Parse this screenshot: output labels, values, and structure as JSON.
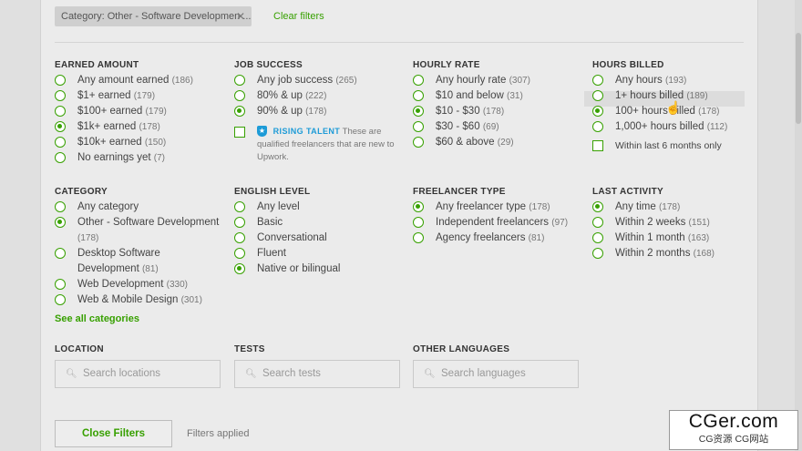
{
  "filter_chip": {
    "label": "Category: Other - Software Developmen ...",
    "close": "✕"
  },
  "clear_filters": "Clear filters",
  "earned_amount": {
    "title": "EARNED AMOUNT",
    "options": [
      {
        "label": "Any amount earned",
        "count": "(186)",
        "selected": false
      },
      {
        "label": "$1+ earned",
        "count": "(179)",
        "selected": false
      },
      {
        "label": "$100+ earned",
        "count": "(179)",
        "selected": false
      },
      {
        "label": "$1k+ earned",
        "count": "(178)",
        "selected": true
      },
      {
        "label": "$10k+ earned",
        "count": "(150)",
        "selected": false
      },
      {
        "label": "No earnings yet",
        "count": "(7)",
        "selected": false
      }
    ]
  },
  "job_success": {
    "title": "JOB SUCCESS",
    "options": [
      {
        "label": "Any job success",
        "count": "(265)",
        "selected": false
      },
      {
        "label": "80% & up",
        "count": "(222)",
        "selected": false
      },
      {
        "label": "90% & up",
        "count": "(178)",
        "selected": true
      }
    ],
    "rising_talent": {
      "label": "RISING TALENT",
      "text": "These are qualified freelancers that are new to Upwork."
    }
  },
  "hourly_rate": {
    "title": "HOURLY RATE",
    "options": [
      {
        "label": "Any hourly rate",
        "count": "(307)",
        "selected": false
      },
      {
        "label": "$10 and below",
        "count": "(31)",
        "selected": false
      },
      {
        "label": "$10 - $30",
        "count": "(178)",
        "selected": true
      },
      {
        "label": "$30 - $60",
        "count": "(69)",
        "selected": false
      },
      {
        "label": "$60 & above",
        "count": "(29)",
        "selected": false
      }
    ]
  },
  "hours_billed": {
    "title": "HOURS BILLED",
    "options": [
      {
        "label": "Any hours",
        "count": "(193)",
        "selected": false
      },
      {
        "label": "1+ hours billed",
        "count": "(189)",
        "selected": false
      },
      {
        "label": "100+ hours billed",
        "count": "(178)",
        "selected": true
      },
      {
        "label": "1,000+ hours billed",
        "count": "(112)",
        "selected": false
      }
    ],
    "recent": "Within last 6 months only"
  },
  "category": {
    "title": "CATEGORY",
    "options": [
      {
        "label": "Any category",
        "count": "",
        "selected": false
      },
      {
        "label": "Other - Software Development",
        "count": "(178)",
        "selected": true
      },
      {
        "label": "Desktop Software Development",
        "count": "(81)",
        "selected": false
      },
      {
        "label": "Web Development",
        "count": "(330)",
        "selected": false
      },
      {
        "label": "Web & Mobile Design",
        "count": "(301)",
        "selected": false
      }
    ],
    "see_all": "See all categories"
  },
  "english_level": {
    "title": "ENGLISH LEVEL",
    "options": [
      {
        "label": "Any level",
        "count": "",
        "selected": false
      },
      {
        "label": "Basic",
        "count": "",
        "selected": false
      },
      {
        "label": "Conversational",
        "count": "",
        "selected": false
      },
      {
        "label": "Fluent",
        "count": "",
        "selected": false
      },
      {
        "label": "Native or bilingual",
        "count": "",
        "selected": true
      }
    ]
  },
  "freelancer_type": {
    "title": "FREELANCER TYPE",
    "options": [
      {
        "label": "Any freelancer type",
        "count": "(178)",
        "selected": true
      },
      {
        "label": "Independent freelancers",
        "count": "(97)",
        "selected": false
      },
      {
        "label": "Agency freelancers",
        "count": "(81)",
        "selected": false
      }
    ]
  },
  "last_activity": {
    "title": "LAST ACTIVITY",
    "options": [
      {
        "label": "Any time",
        "count": "(178)",
        "selected": true
      },
      {
        "label": "Within 2 weeks",
        "count": "(151)",
        "selected": false
      },
      {
        "label": "Within 1 month",
        "count": "(163)",
        "selected": false
      },
      {
        "label": "Within 2 months",
        "count": "(168)",
        "selected": false
      }
    ]
  },
  "location": {
    "title": "LOCATION",
    "placeholder": "Search locations"
  },
  "tests": {
    "title": "TESTS",
    "placeholder": "Search tests"
  },
  "languages": {
    "title": "OTHER LANGUAGES",
    "placeholder": "Search languages"
  },
  "close_filters": "Close Filters",
  "filters_applied": "Filters applied",
  "watermark": {
    "big": "CGer.com",
    "small": "CG资源 CG网站"
  },
  "colors": {
    "accent": "#37a000",
    "rising": "#1d9bd7"
  }
}
